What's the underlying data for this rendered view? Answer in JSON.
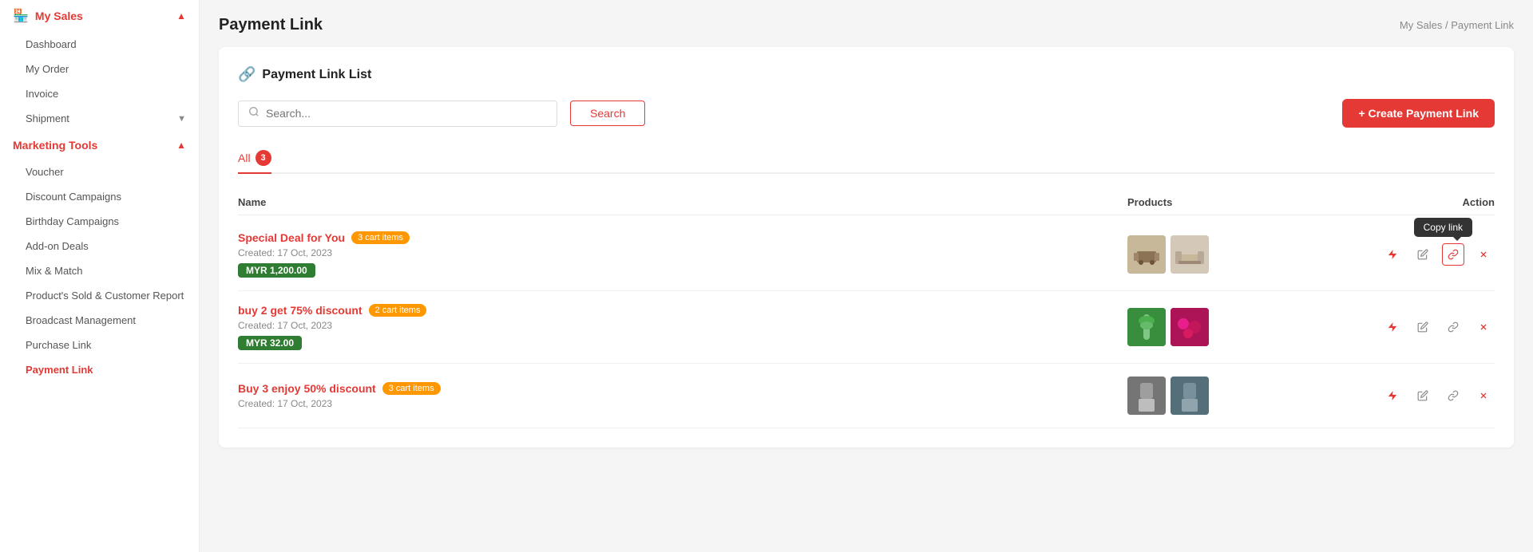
{
  "sidebar": {
    "section": "My Sales",
    "items": [
      {
        "id": "dashboard",
        "label": "Dashboard",
        "active": false
      },
      {
        "id": "my-order",
        "label": "My Order",
        "active": false
      },
      {
        "id": "invoice",
        "label": "Invoice",
        "active": false
      },
      {
        "id": "shipment",
        "label": "Shipment",
        "active": false
      },
      {
        "id": "marketing-tools",
        "label": "Marketing Tools",
        "active": false,
        "expanded": true
      },
      {
        "id": "voucher",
        "label": "Voucher",
        "active": false,
        "sub": true
      },
      {
        "id": "discount-campaigns",
        "label": "Discount Campaigns",
        "active": false,
        "sub": true
      },
      {
        "id": "birthday-campaigns",
        "label": "Birthday Campaigns",
        "active": false,
        "sub": true
      },
      {
        "id": "add-on-deals",
        "label": "Add-on Deals",
        "active": false,
        "sub": true
      },
      {
        "id": "mix-match",
        "label": "Mix & Match",
        "active": false,
        "sub": true
      },
      {
        "id": "products-sold",
        "label": "Product's Sold & Customer Report",
        "active": false,
        "sub": true
      },
      {
        "id": "broadcast",
        "label": "Broadcast Management",
        "active": false,
        "sub": true
      },
      {
        "id": "purchase-link",
        "label": "Purchase Link",
        "active": false,
        "sub": true
      },
      {
        "id": "payment-link",
        "label": "Payment Link",
        "active": true,
        "sub": true
      }
    ]
  },
  "breadcrumb": {
    "parent": "My Sales",
    "current": "Payment Link",
    "separator": "/"
  },
  "page": {
    "title": "Payment Link",
    "card_title": "Payment Link List"
  },
  "search": {
    "placeholder": "Search...",
    "button_label": "Search"
  },
  "create_button": {
    "label": "+ Create Payment Link"
  },
  "tabs": [
    {
      "id": "all",
      "label": "All",
      "count": 3,
      "active": true
    }
  ],
  "table": {
    "columns": [
      "Name",
      "Products",
      "Action"
    ],
    "rows": [
      {
        "id": "row1",
        "name": "Special Deal for You",
        "cart_count": "3 cart items",
        "created": "Created: 17 Oct, 2023",
        "price": "MYR 1,200.00",
        "thumbs": [
          "table",
          "sofa"
        ],
        "show_tooltip": true
      },
      {
        "id": "row2",
        "name": "buy 2 get 75% discount",
        "cart_count": "2 cart items",
        "created": "Created: 17 Oct, 2023",
        "price": "MYR 32.00",
        "thumbs": [
          "bottle",
          "berries"
        ],
        "show_tooltip": false
      },
      {
        "id": "row3",
        "name": "Buy 3 enjoy 50% discount",
        "cart_count": "3 cart items",
        "created": "Created: 17 Oct, 2023",
        "price": null,
        "thumbs": [
          "person1",
          "person2"
        ],
        "show_tooltip": false
      }
    ]
  },
  "tooltip": {
    "copy_link": "Copy link"
  },
  "icons": {
    "flash": "⚡",
    "edit": "✏️",
    "link": "🔗",
    "delete": "✕",
    "search": "🔍",
    "chain": "🔗"
  },
  "colors": {
    "primary": "#e53935",
    "success": "#2e7d32",
    "warning": "#ff9800"
  }
}
